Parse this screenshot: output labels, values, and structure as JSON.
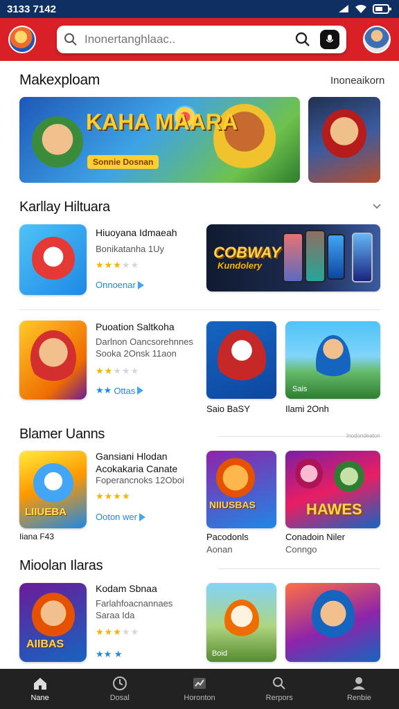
{
  "status_bar": {
    "time": "3133 7142"
  },
  "header": {
    "search_placeholder": "Inonertanghlaac..",
    "colors": {
      "bar": "#d92027",
      "status": "#0f2f63"
    }
  },
  "featured": {
    "title": "Makexploam",
    "link": "Inoneaikorn",
    "banner_title": "KAHA MAARA",
    "banner_sub": "Sonnie Dosnan"
  },
  "section2": {
    "title": "Karllay Hiltuara",
    "apps": [
      {
        "name": "Hiuoyana Idmaeah",
        "meta": "Bonikatanha 1Uy",
        "rating": 3,
        "action": "Onnoenar"
      },
      {
        "name": "Puoation Saltkoha",
        "meta": "Darlnon Oancsorehnnes\nSooka 2Onsk 11aon",
        "rating": 2,
        "action": "Ottas"
      }
    ],
    "promo_title": "COBWAY",
    "promo_sub": "Kundolery",
    "tiles": [
      {
        "label": "Saio BaSY"
      },
      {
        "label": "Ilami 2Onh",
        "badge": "Sais"
      }
    ]
  },
  "section3": {
    "title": "Blamer Uanns",
    "link": "Inodondeaton",
    "app": {
      "name": "Gansiani Hlodan\nAcokakaria Canate",
      "meta": "Foperancnoks 12Oboi",
      "rating": 4,
      "action": "Ooton wer",
      "caption": "Iiana F43",
      "icon_text": "LIIUEBA"
    },
    "tiles": [
      {
        "label": "Pacodonls",
        "sub": "Aonan",
        "art": "NIIUSBAS"
      },
      {
        "label": "Conadoin Niler",
        "sub": "Conngo",
        "art": "HAWES"
      }
    ]
  },
  "section4": {
    "title": "Mioolan Ilaras",
    "app": {
      "name": "Kodam Sbnaa",
      "meta": "Farlahfoacnannaes\nSaraa Ida",
      "rating": 3,
      "icon_text": "AIIBAS"
    },
    "tiles": [
      {
        "label": "Boid"
      },
      {
        "label": ""
      }
    ]
  },
  "bottom_nav": [
    {
      "label": "Nane",
      "icon": "home-icon"
    },
    {
      "label": "Dosal",
      "icon": "clock-icon"
    },
    {
      "label": "Horonton",
      "icon": "chart-icon"
    },
    {
      "label": "Rerpors",
      "icon": "search-icon"
    },
    {
      "label": "Renbie",
      "icon": "profile-icon"
    }
  ]
}
